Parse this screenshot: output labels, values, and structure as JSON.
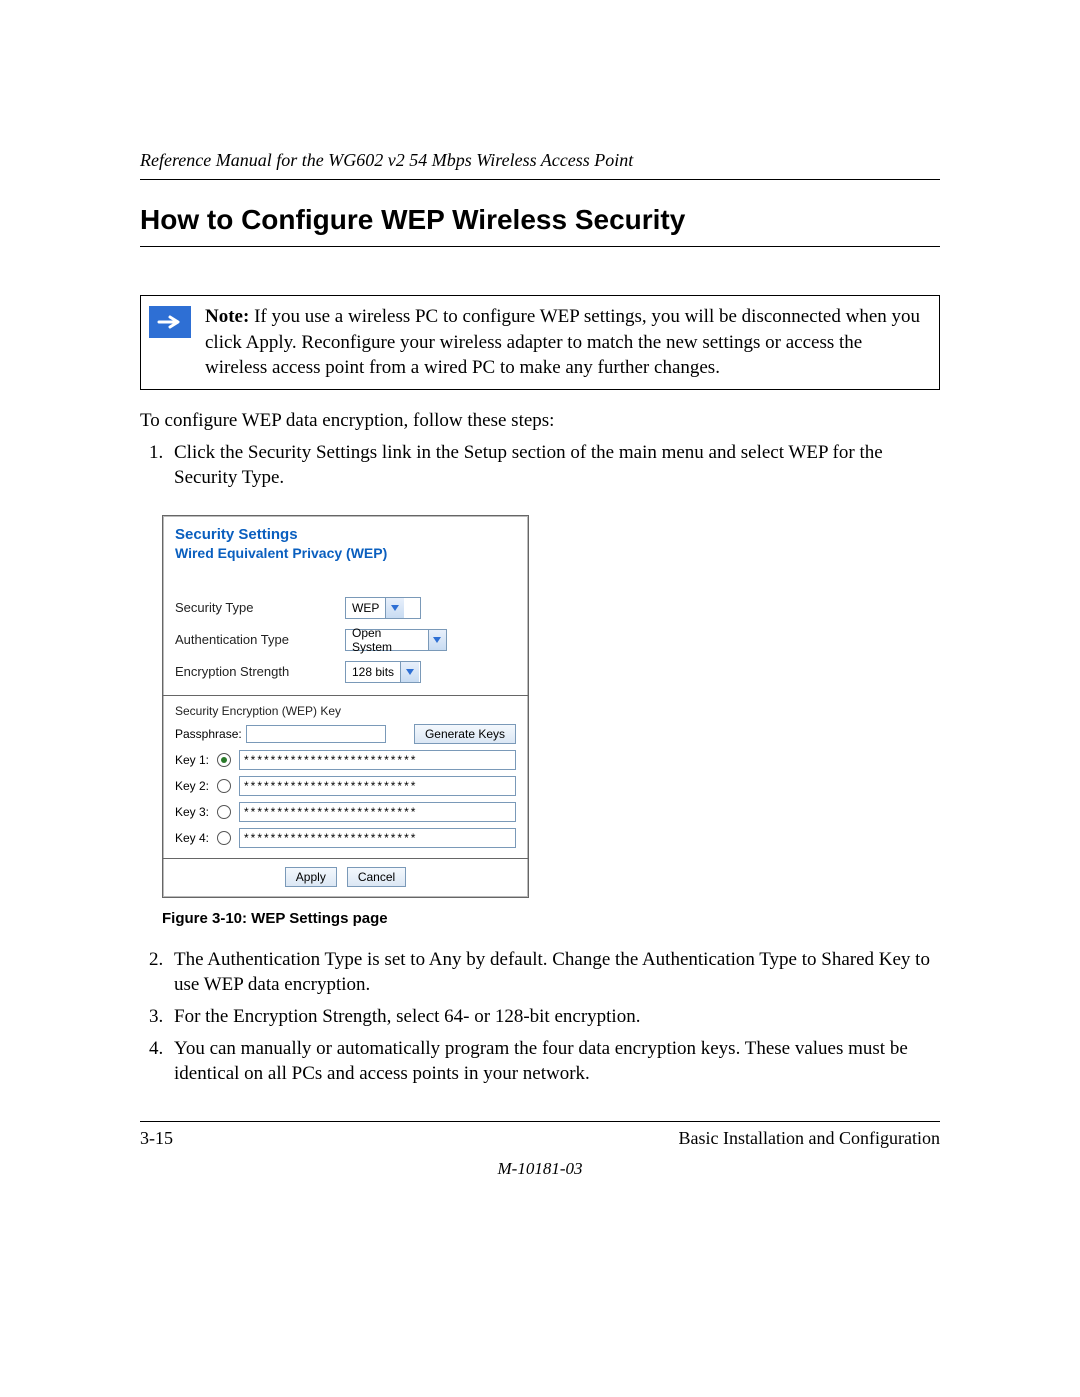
{
  "header": {
    "running": "Reference Manual for the WG602 v2 54 Mbps Wireless Access Point"
  },
  "title": "How to Configure WEP Wireless Security",
  "note": {
    "label": "Note:",
    "text": "If you use a wireless PC to configure WEP settings, you will be disconnected when you click Apply. Reconfigure your wireless adapter to match the new settings or access the wireless access point from a wired PC to make any further changes."
  },
  "intro": "To configure WEP data encryption, follow these steps:",
  "steps": {
    "s1": "Click the Security Settings link in the Setup section of the main menu and select WEP for the Security Type.",
    "s2": "The Authentication Type is set to Any by default. Change the Authentication Type to Shared Key to use WEP data encryption.",
    "s3": "For the Encryption Strength, select 64- or 128-bit encryption.",
    "s4": "You can manually or automatically program the four data encryption keys. These values must be identical on all PCs and access points in your network."
  },
  "screenshot": {
    "title1": "Security Settings",
    "title2": "Wired Equivalent Privacy (WEP)",
    "labels": {
      "security_type": "Security Type",
      "auth_type": "Authentication Type",
      "enc_strength": "Encryption Strength",
      "sec_key": "Security Encryption (WEP) Key",
      "passphrase": "Passphrase:",
      "key1": "Key 1:",
      "key2": "Key 2:",
      "key3": "Key 3:",
      "key4": "Key 4:"
    },
    "values": {
      "security_type": "WEP",
      "auth_type": "Open System",
      "enc_strength": "128 bits",
      "passphrase": "",
      "key_mask": "**************************"
    },
    "buttons": {
      "generate": "Generate Keys",
      "apply": "Apply",
      "cancel": "Cancel"
    }
  },
  "figure_caption": "Figure 3-10: WEP Settings page",
  "footer": {
    "page_num": "3-15",
    "chapter": "Basic Installation and Configuration",
    "doc_id": "M-10181-03"
  }
}
